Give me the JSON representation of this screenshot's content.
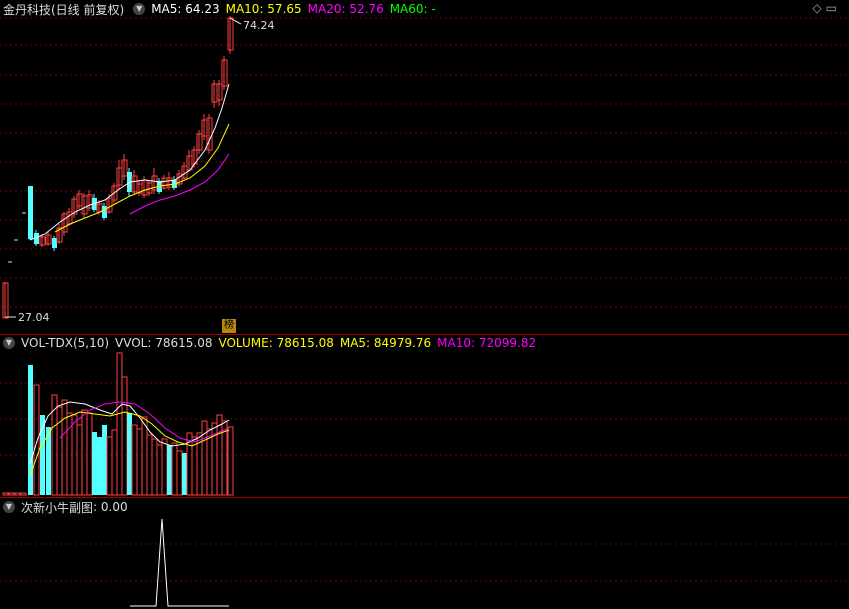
{
  "main": {
    "title": "金丹科技(日线 前复权)",
    "ma5": "MA5: 64.23",
    "ma10": "MA10: 57.65",
    "ma20": "MA20: 52.76",
    "ma60": "MA60: -",
    "high_label": "74.24",
    "low_label": "27.04",
    "badge": "榜"
  },
  "vol": {
    "title": "VOL-TDX(5,10)",
    "vvol": "VVOL: 78615.08",
    "volume": "VOLUME: 78615.08",
    "ma5": "MA5: 84979.76",
    "ma10": "MA10: 72099.82"
  },
  "sub": {
    "title": "次新小牛副图",
    "value": ": 0.00"
  },
  "colors": {
    "up": "#ff4040",
    "down": "#54ffff",
    "ma5": "#ffffff",
    "ma10": "#ffff00",
    "ma20": "#ff00ff",
    "ma60": "#00ff00",
    "grid": "#7a0000"
  },
  "icons": [
    "caret-down-icon",
    "diamond-icon",
    "expand-icon"
  ]
}
